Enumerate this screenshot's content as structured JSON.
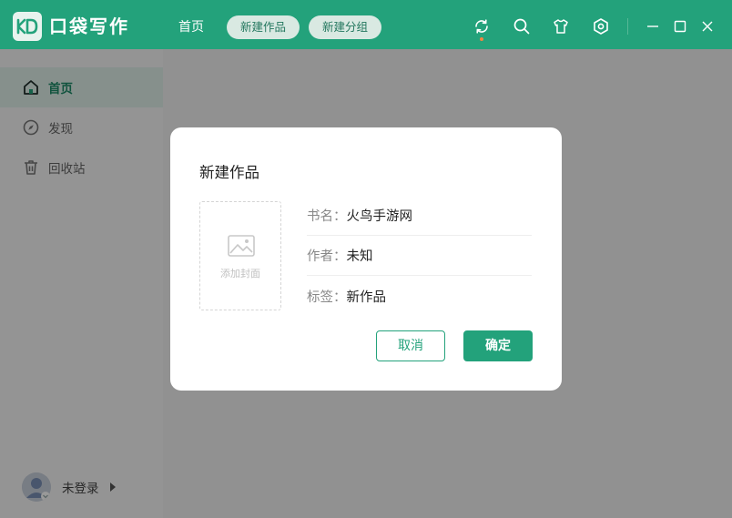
{
  "app": {
    "title": "口袋写作",
    "logo_text": "KD"
  },
  "topnav": {
    "home": "首页",
    "new_work": "新建作品",
    "new_group": "新建分组"
  },
  "toolbar_icons": [
    "sync-icon",
    "search-icon",
    "tshirt-icon",
    "settings-icon",
    "minimize-icon",
    "maximize-icon",
    "close-icon"
  ],
  "sidebar": {
    "items": [
      {
        "label": "首页",
        "icon": "home-icon",
        "active": true
      },
      {
        "label": "发现",
        "icon": "compass-icon",
        "active": false
      },
      {
        "label": "回收站",
        "icon": "trash-icon",
        "active": false
      }
    ],
    "user": {
      "name": "未登录"
    }
  },
  "dialog": {
    "title": "新建作品",
    "cover_label": "添加封面",
    "fields": [
      {
        "key": "书名：",
        "value": "火鸟手游网"
      },
      {
        "key": "作者：",
        "value": "未知"
      },
      {
        "key": "标签：",
        "value": "新作品"
      }
    ],
    "cancel": "取消",
    "confirm": "确定"
  },
  "colors": {
    "brand": "#23a27b",
    "accent_dot": "#f4843f"
  }
}
